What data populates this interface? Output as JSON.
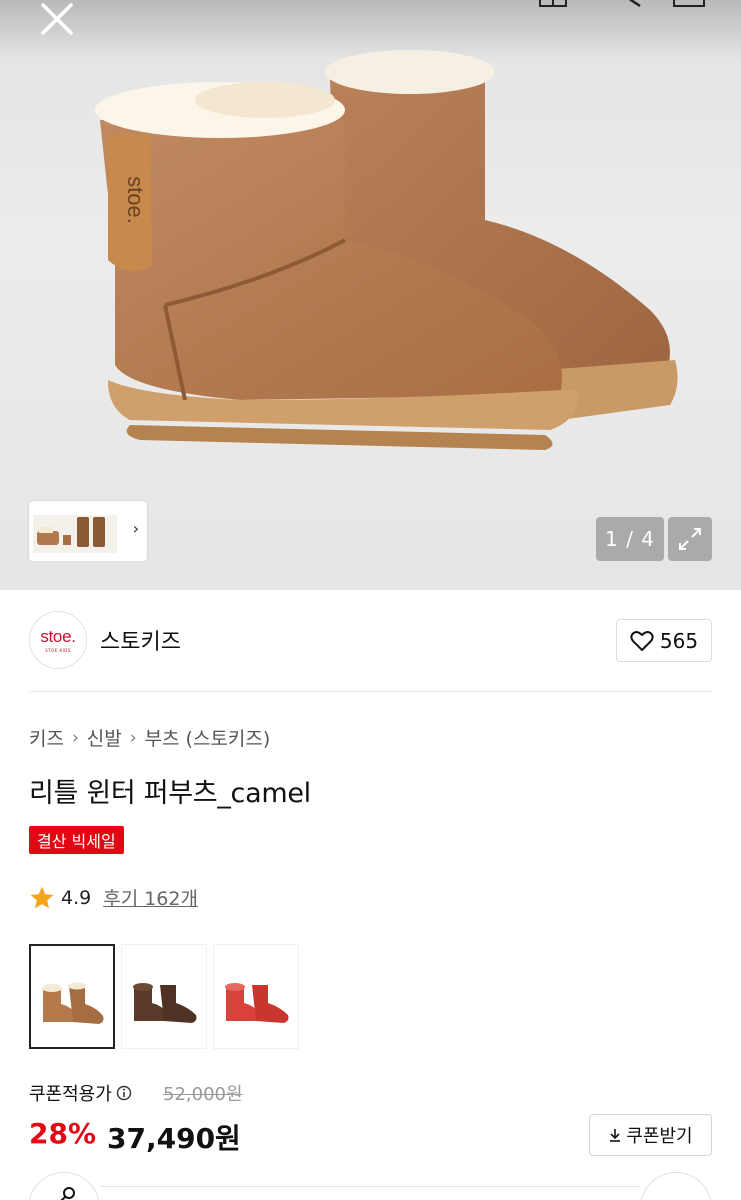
{
  "gallery": {
    "counter": "1 / 4",
    "close_icon": "close-icon",
    "expand_icon": "expand-icon",
    "boot_label": "stoe."
  },
  "brand": {
    "logo_text": "stoe.",
    "logo_sub": "STOE KIDS",
    "name": "스토키즈",
    "like_count": "565",
    "accent": "#c8102e"
  },
  "breadcrumb": [
    "키즈",
    "신발",
    "부츠 (스토키즈)"
  ],
  "product": {
    "title": "리틀 윈터 퍼부츠_camel",
    "badge": "결산 빅세일",
    "rating": "4.9",
    "reviews": "후기 162개"
  },
  "colors": [
    {
      "name": "camel",
      "hex": "#b57a4c"
    },
    {
      "name": "brown",
      "hex": "#5a3a2a"
    },
    {
      "name": "red",
      "hex": "#d9423a"
    }
  ],
  "price": {
    "coupon_label": "쿠폰적용가",
    "original": "52,000원",
    "discount": "28%",
    "sale": "37,490원",
    "coupon_button": "쿠폰받기",
    "sale_color": "#e30613"
  }
}
